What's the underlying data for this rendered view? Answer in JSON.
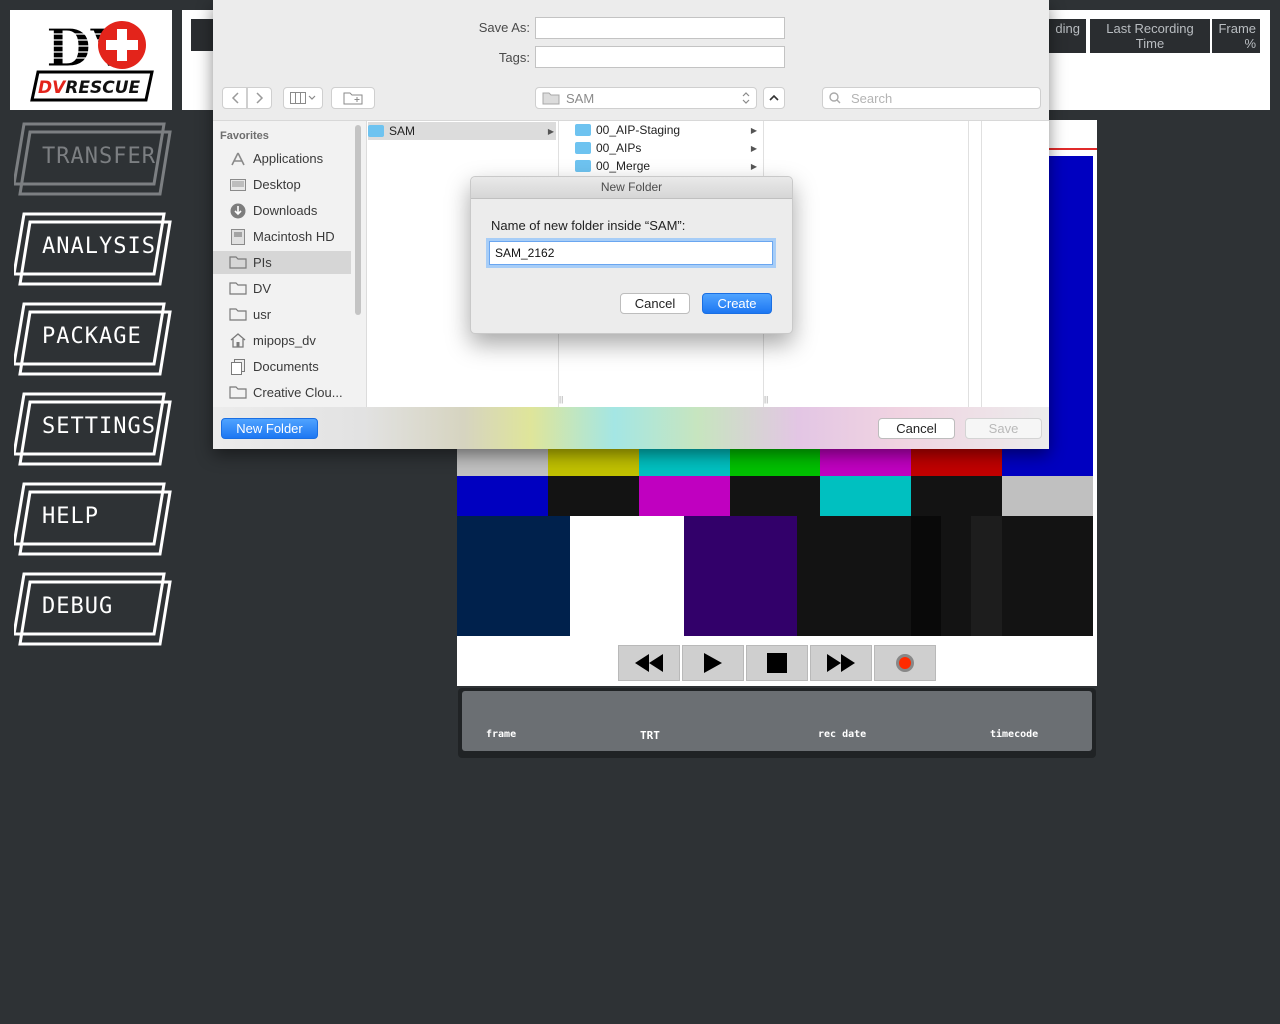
{
  "app": {
    "logo_text": "DVRESCUE",
    "nav": [
      {
        "label": "TRANSFER",
        "active": false
      },
      {
        "label": "ANALYSIS",
        "active": true
      },
      {
        "label": "PACKAGE",
        "active": true
      },
      {
        "label": "SETTINGS",
        "active": true
      },
      {
        "label": "HELP",
        "active": true
      },
      {
        "label": "DEBUG",
        "active": true
      }
    ],
    "table_headers": [
      "ding",
      "Last Recording\nTime",
      "Frame\n%"
    ]
  },
  "readout": {
    "frame": "frame",
    "trt": "TRT",
    "rec_date": "rec date",
    "timecode": "timecode"
  },
  "colors": {
    "background": "#2e3235",
    "accent_blue": "#1d77f2",
    "record_red": "#ff2a00"
  },
  "save_sheet": {
    "save_as_label": "Save As:",
    "save_as_value": "",
    "tags_label": "Tags:",
    "tags_value": "",
    "location": "SAM",
    "search_placeholder": "Search",
    "sidebar_heading": "Favorites",
    "sidebar_items": [
      {
        "label": "Applications",
        "icon": "applications-icon"
      },
      {
        "label": "Desktop",
        "icon": "desktop-icon"
      },
      {
        "label": "Downloads",
        "icon": "downloads-icon"
      },
      {
        "label": "Macintosh HD",
        "icon": "harddrive-icon"
      },
      {
        "label": "PIs",
        "icon": "folder-icon",
        "selected": true
      },
      {
        "label": "DV",
        "icon": "folder-icon"
      },
      {
        "label": "usr",
        "icon": "folder-icon"
      },
      {
        "label": "mipops_dv",
        "icon": "home-icon"
      },
      {
        "label": "Documents",
        "icon": "documents-icon"
      },
      {
        "label": "Creative Clou...",
        "icon": "folder-icon"
      }
    ],
    "column1": [
      {
        "label": "SAM",
        "selected": true
      }
    ],
    "column2": [
      {
        "label": "00_AIP-Staging"
      },
      {
        "label": "00_AIPs"
      },
      {
        "label": "00_Merge"
      }
    ],
    "new_folder_label": "New Folder",
    "cancel_label": "Cancel",
    "save_label": "Save"
  },
  "dialog": {
    "title": "New Folder",
    "prompt": "Name of new folder inside “SAM”:",
    "value": "SAM_2162",
    "cancel_label": "Cancel",
    "create_label": "Create"
  }
}
